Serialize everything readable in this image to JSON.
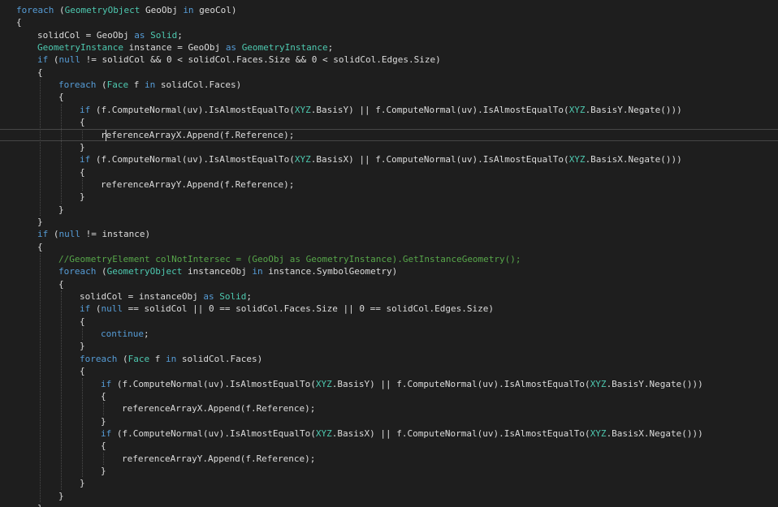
{
  "editor": {
    "language": "C#",
    "colors": {
      "background": "#1e1e1e",
      "plain": "#dcdcdc",
      "keyword": "#569cd6",
      "type": "#4ec9b0",
      "comment": "#57a64a",
      "current_line_border": "#464646"
    },
    "current_line": 10,
    "lines": [
      {
        "indent": 0,
        "segs": [
          [
            "kw",
            "foreach"
          ],
          [
            "pl",
            " ("
          ],
          [
            "ty",
            "GeometryObject"
          ],
          [
            "pl",
            " GeoObj "
          ],
          [
            "kw",
            "in"
          ],
          [
            "pl",
            " geoCol)"
          ]
        ]
      },
      {
        "indent": 0,
        "segs": [
          [
            "pl",
            "{"
          ]
        ]
      },
      {
        "indent": 1,
        "segs": [
          [
            "pl",
            "solidCol = GeoObj "
          ],
          [
            "kw",
            "as"
          ],
          [
            "pl",
            " "
          ],
          [
            "ty",
            "Solid"
          ],
          [
            "pl",
            ";"
          ]
        ]
      },
      {
        "indent": 1,
        "segs": [
          [
            "ty",
            "GeometryInstance"
          ],
          [
            "pl",
            " instance = GeoObj "
          ],
          [
            "kw",
            "as"
          ],
          [
            "pl",
            " "
          ],
          [
            "ty",
            "GeometryInstance"
          ],
          [
            "pl",
            ";"
          ]
        ]
      },
      {
        "indent": 1,
        "segs": [
          [
            "kw",
            "if"
          ],
          [
            "pl",
            " ("
          ],
          [
            "kw",
            "null"
          ],
          [
            "pl",
            " != solidCol && 0 < solidCol.Faces.Size && 0 < solidCol.Edges.Size)"
          ]
        ]
      },
      {
        "indent": 1,
        "segs": [
          [
            "pl",
            "{"
          ]
        ]
      },
      {
        "indent": 2,
        "segs": [
          [
            "kw",
            "foreach"
          ],
          [
            "pl",
            " ("
          ],
          [
            "ty",
            "Face"
          ],
          [
            "pl",
            " f "
          ],
          [
            "kw",
            "in"
          ],
          [
            "pl",
            " solidCol.Faces)"
          ]
        ]
      },
      {
        "indent": 2,
        "segs": [
          [
            "pl",
            "{"
          ]
        ]
      },
      {
        "indent": 3,
        "segs": [
          [
            "kw",
            "if"
          ],
          [
            "pl",
            " (f.ComputeNormal(uv).IsAlmostEqualTo("
          ],
          [
            "ty",
            "XYZ"
          ],
          [
            "pl",
            ".BasisY) || f.ComputeNormal(uv).IsAlmostEqualTo("
          ],
          [
            "ty",
            "XYZ"
          ],
          [
            "pl",
            ".BasisY.Negate()))"
          ]
        ]
      },
      {
        "indent": 3,
        "segs": [
          [
            "pl",
            "{"
          ]
        ]
      },
      {
        "indent": 4,
        "segs": [
          [
            "pl",
            "referenceArrayX.Append(f.Reference);"
          ]
        ]
      },
      {
        "indent": 3,
        "segs": [
          [
            "pl",
            "}"
          ]
        ]
      },
      {
        "indent": 3,
        "segs": [
          [
            "kw",
            "if"
          ],
          [
            "pl",
            " (f.ComputeNormal(uv).IsAlmostEqualTo("
          ],
          [
            "ty",
            "XYZ"
          ],
          [
            "pl",
            ".BasisX) || f.ComputeNormal(uv).IsAlmostEqualTo("
          ],
          [
            "ty",
            "XYZ"
          ],
          [
            "pl",
            ".BasisX.Negate()))"
          ]
        ]
      },
      {
        "indent": 3,
        "segs": [
          [
            "pl",
            "{"
          ]
        ]
      },
      {
        "indent": 4,
        "segs": [
          [
            "pl",
            "referenceArrayY.Append(f.Reference);"
          ]
        ]
      },
      {
        "indent": 3,
        "segs": [
          [
            "pl",
            "}"
          ]
        ]
      },
      {
        "indent": 2,
        "segs": [
          [
            "pl",
            "}"
          ]
        ]
      },
      {
        "indent": 1,
        "segs": [
          [
            "pl",
            "}"
          ]
        ]
      },
      {
        "indent": 1,
        "segs": [
          [
            "kw",
            "if"
          ],
          [
            "pl",
            " ("
          ],
          [
            "kw",
            "null"
          ],
          [
            "pl",
            " != instance)"
          ]
        ]
      },
      {
        "indent": 1,
        "segs": [
          [
            "pl",
            "{"
          ]
        ]
      },
      {
        "indent": 2,
        "segs": [
          [
            "cm",
            "//GeometryElement colNotIntersec = (GeoObj as GeometryInstance).GetInstanceGeometry();"
          ]
        ]
      },
      {
        "indent": 2,
        "segs": [
          [
            "kw",
            "foreach"
          ],
          [
            "pl",
            " ("
          ],
          [
            "ty",
            "GeometryObject"
          ],
          [
            "pl",
            " instanceObj "
          ],
          [
            "kw",
            "in"
          ],
          [
            "pl",
            " instance.SymbolGeometry)"
          ]
        ]
      },
      {
        "indent": 2,
        "segs": [
          [
            "pl",
            "{"
          ]
        ]
      },
      {
        "indent": 3,
        "segs": [
          [
            "pl",
            "solidCol = instanceObj "
          ],
          [
            "kw",
            "as"
          ],
          [
            "pl",
            " "
          ],
          [
            "ty",
            "Solid"
          ],
          [
            "pl",
            ";"
          ]
        ]
      },
      {
        "indent": 3,
        "segs": [
          [
            "kw",
            "if"
          ],
          [
            "pl",
            " ("
          ],
          [
            "kw",
            "null"
          ],
          [
            "pl",
            " == solidCol || 0 == solidCol.Faces.Size || 0 == solidCol.Edges.Size)"
          ]
        ]
      },
      {
        "indent": 3,
        "segs": [
          [
            "pl",
            "{"
          ]
        ]
      },
      {
        "indent": 4,
        "segs": [
          [
            "kw",
            "continue"
          ],
          [
            "pl",
            ";"
          ]
        ]
      },
      {
        "indent": 3,
        "segs": [
          [
            "pl",
            "}"
          ]
        ]
      },
      {
        "indent": 3,
        "segs": [
          [
            "kw",
            "foreach"
          ],
          [
            "pl",
            " ("
          ],
          [
            "ty",
            "Face"
          ],
          [
            "pl",
            " f "
          ],
          [
            "kw",
            "in"
          ],
          [
            "pl",
            " solidCol.Faces)"
          ]
        ]
      },
      {
        "indent": 3,
        "segs": [
          [
            "pl",
            "{"
          ]
        ]
      },
      {
        "indent": 4,
        "segs": [
          [
            "kw",
            "if"
          ],
          [
            "pl",
            " (f.ComputeNormal(uv).IsAlmostEqualTo("
          ],
          [
            "ty",
            "XYZ"
          ],
          [
            "pl",
            ".BasisY) || f.ComputeNormal(uv).IsAlmostEqualTo("
          ],
          [
            "ty",
            "XYZ"
          ],
          [
            "pl",
            ".BasisY.Negate()))"
          ]
        ]
      },
      {
        "indent": 4,
        "segs": [
          [
            "pl",
            "{"
          ]
        ]
      },
      {
        "indent": 5,
        "segs": [
          [
            "pl",
            "referenceArrayX.Append(f.Reference);"
          ]
        ]
      },
      {
        "indent": 4,
        "segs": [
          [
            "pl",
            "}"
          ]
        ]
      },
      {
        "indent": 4,
        "segs": [
          [
            "kw",
            "if"
          ],
          [
            "pl",
            " (f.ComputeNormal(uv).IsAlmostEqualTo("
          ],
          [
            "ty",
            "XYZ"
          ],
          [
            "pl",
            ".BasisX) || f.ComputeNormal(uv).IsAlmostEqualTo("
          ],
          [
            "ty",
            "XYZ"
          ],
          [
            "pl",
            ".BasisX.Negate()))"
          ]
        ]
      },
      {
        "indent": 4,
        "segs": [
          [
            "pl",
            "{"
          ]
        ]
      },
      {
        "indent": 5,
        "segs": [
          [
            "pl",
            "referenceArrayY.Append(f.Reference);"
          ]
        ]
      },
      {
        "indent": 4,
        "segs": [
          [
            "pl",
            "}"
          ]
        ]
      },
      {
        "indent": 3,
        "segs": [
          [
            "pl",
            "}"
          ]
        ]
      },
      {
        "indent": 2,
        "segs": [
          [
            "pl",
            "}"
          ]
        ]
      },
      {
        "indent": 1,
        "segs": [
          [
            "pl",
            "}"
          ]
        ]
      }
    ]
  }
}
